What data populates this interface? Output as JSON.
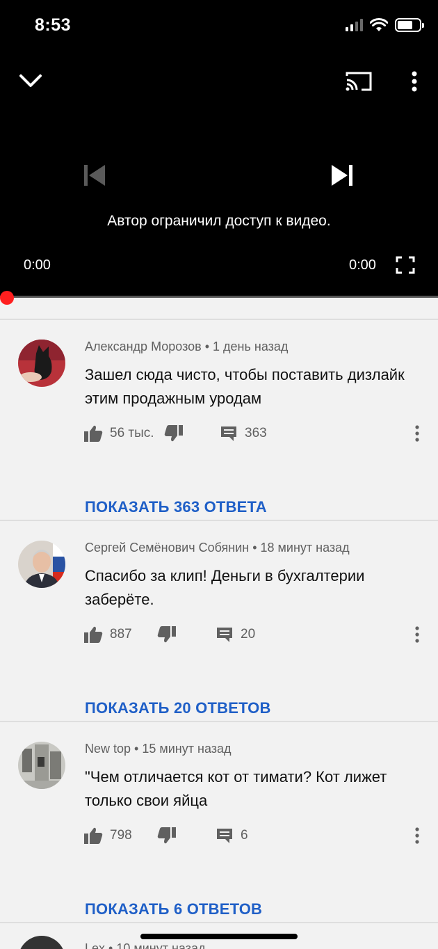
{
  "status_bar": {
    "time": "8:53"
  },
  "player": {
    "message": "Автор ограничил доступ к видео.",
    "current_time": "0:00",
    "duration": "0:00",
    "progress": 0,
    "accent_color": "#ff1f1f"
  },
  "comments": [
    {
      "author": "Александр Морозов",
      "age": "1 день назад",
      "text": "Зашел сюда чисто, чтобы поставить дизлайк этим продажным уродам",
      "likes": "56 тыс.",
      "replies": "363",
      "show_replies": "ПОКАЗАТЬ 363 ОТВЕТА"
    },
    {
      "author": "Сергей Семёнович Собянин",
      "age": "18 минут назад",
      "text": "Спасибо за клип! Деньги в бухгалтерии заберёте.",
      "likes": "887",
      "replies": "20",
      "show_replies": "ПОКАЗАТЬ 20 ОТВЕТОВ"
    },
    {
      "author": "New top",
      "age": "15 минут назад",
      "text": "\"Чем отличается кот от тимати? Кот лижет только свои яйца",
      "likes": "798",
      "replies": "6",
      "show_replies": "ПОКАЗАТЬ 6 ОТВЕТОВ"
    }
  ],
  "partial_comment": {
    "meta": "Lex • 10 минут назад"
  },
  "colors": {
    "link": "#1f5fc7",
    "background": "#f2f2f2"
  }
}
